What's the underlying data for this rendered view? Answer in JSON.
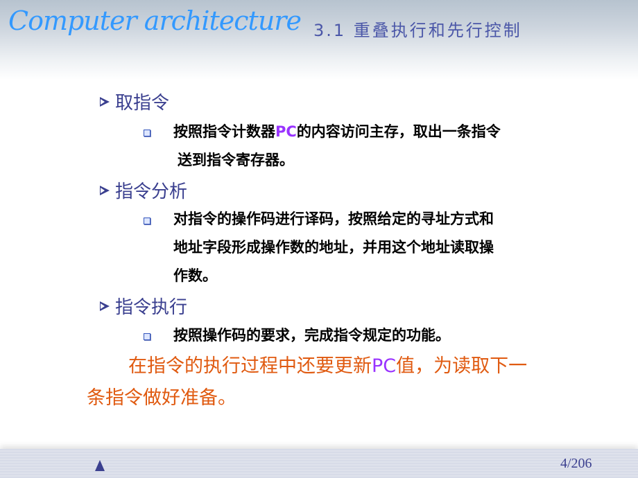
{
  "header": {
    "brand": "Computer architecture",
    "section_title": "3.1 重叠执行和先行控制"
  },
  "sections": [
    {
      "heading": "取指令",
      "bullets": [
        {
          "pre": "按照指令计数器",
          "highlight": "PC",
          "post": "的内容访问主存，取出一条指令",
          "line2": "送到指令寄存器。"
        }
      ]
    },
    {
      "heading": "指令分析",
      "bullets": [
        {
          "line1": "对指令的操作码进行译码，按照给定的寻址方式和",
          "line2": "地址字段形成操作数的地址，并用这个地址读取操",
          "line3": "作数。"
        }
      ]
    },
    {
      "heading": "指令执行",
      "bullets": [
        {
          "line1": "按照操作码的要求，完成指令规定的功能。"
        }
      ]
    }
  ],
  "note": {
    "pre": "在指令的执行过程中还要更新",
    "highlight": "PC",
    "post": "值，为读取下一",
    "line2": "条指令做好准备。"
  },
  "footer": {
    "nav_icon": "up-triangle",
    "page": "4/206"
  },
  "colors": {
    "brand": "#3399ff",
    "heading": "#3a3f8f",
    "highlight": "#9933ff",
    "note": "#e05a10"
  }
}
